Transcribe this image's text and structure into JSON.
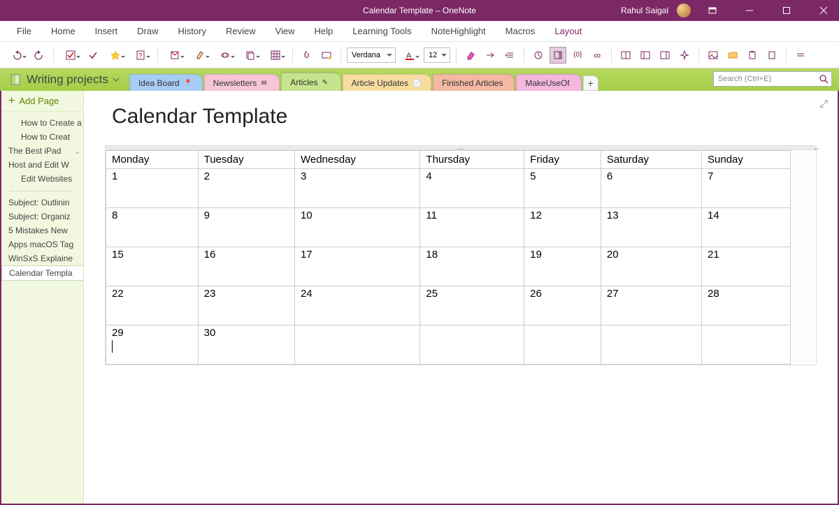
{
  "window": {
    "title": "Calendar Template  –  OneNote",
    "user": "Rahul Saigal"
  },
  "menu": [
    "File",
    "Home",
    "Insert",
    "Draw",
    "History",
    "Review",
    "View",
    "Help",
    "Learning Tools",
    "NoteHighlight",
    "Macros",
    "Layout"
  ],
  "menu_active_index": 11,
  "font": {
    "name": "Verdana",
    "size": "12"
  },
  "notebook": "Writing projects",
  "tabs": [
    {
      "label": "Idea Board",
      "color": "#a8cdf4",
      "icon": "pin"
    },
    {
      "label": "Newsletters",
      "color": "#f6c6d8",
      "icon": "mail"
    },
    {
      "label": "Articles",
      "color": "#c6e48f",
      "icon": "edit",
      "active": true
    },
    {
      "label": "Article Updates",
      "color": "#f7dca1",
      "icon": "page"
    },
    {
      "label": "Finished Articles",
      "color": "#f4b8a4",
      "icon": ""
    },
    {
      "label": "MakeUseOf",
      "color": "#f4b8df",
      "icon": ""
    }
  ],
  "search_placeholder": "Search (Ctrl+E)",
  "sidebar": {
    "add_label": "Add Page",
    "pages": [
      {
        "label": "How to Create a",
        "indent": true
      },
      {
        "label": "How to Creat",
        "indent": true
      },
      {
        "label": "The Best iPad",
        "less": true,
        "hasChildren": true
      },
      {
        "label": "Host and Edit W",
        "less": true
      },
      {
        "label": "Edit Websites",
        "indent": true
      },
      {
        "sep": true,
        "label": "----------------------"
      },
      {
        "label": "Subject: Outlinin",
        "less": true
      },
      {
        "label": "Subject: Organiz",
        "less": true
      },
      {
        "label": "5 Mistakes New",
        "less": true
      },
      {
        "label": "Apps macOS Tag",
        "less": true
      },
      {
        "label": "WinSxS Explaine",
        "less": true
      },
      {
        "label": "Calendar Templa",
        "less": true,
        "selected": true
      }
    ]
  },
  "page_title": "Calendar Template",
  "calendar": {
    "headers": [
      "Monday",
      "Tuesday",
      "Wednesday",
      "Thursday",
      "Friday",
      "Saturday",
      "Sunday"
    ],
    "rows": [
      [
        "1",
        "2",
        "3",
        "4",
        "5",
        "6",
        "7"
      ],
      [
        "8",
        "9",
        "10",
        "11",
        "12",
        "13",
        "14"
      ],
      [
        "15",
        "16",
        "17",
        "18",
        "19",
        "20",
        "21"
      ],
      [
        "22",
        "23",
        "24",
        "25",
        "26",
        "27",
        "28"
      ],
      [
        "29",
        "30",
        "",
        "",
        "",
        "",
        ""
      ]
    ]
  }
}
